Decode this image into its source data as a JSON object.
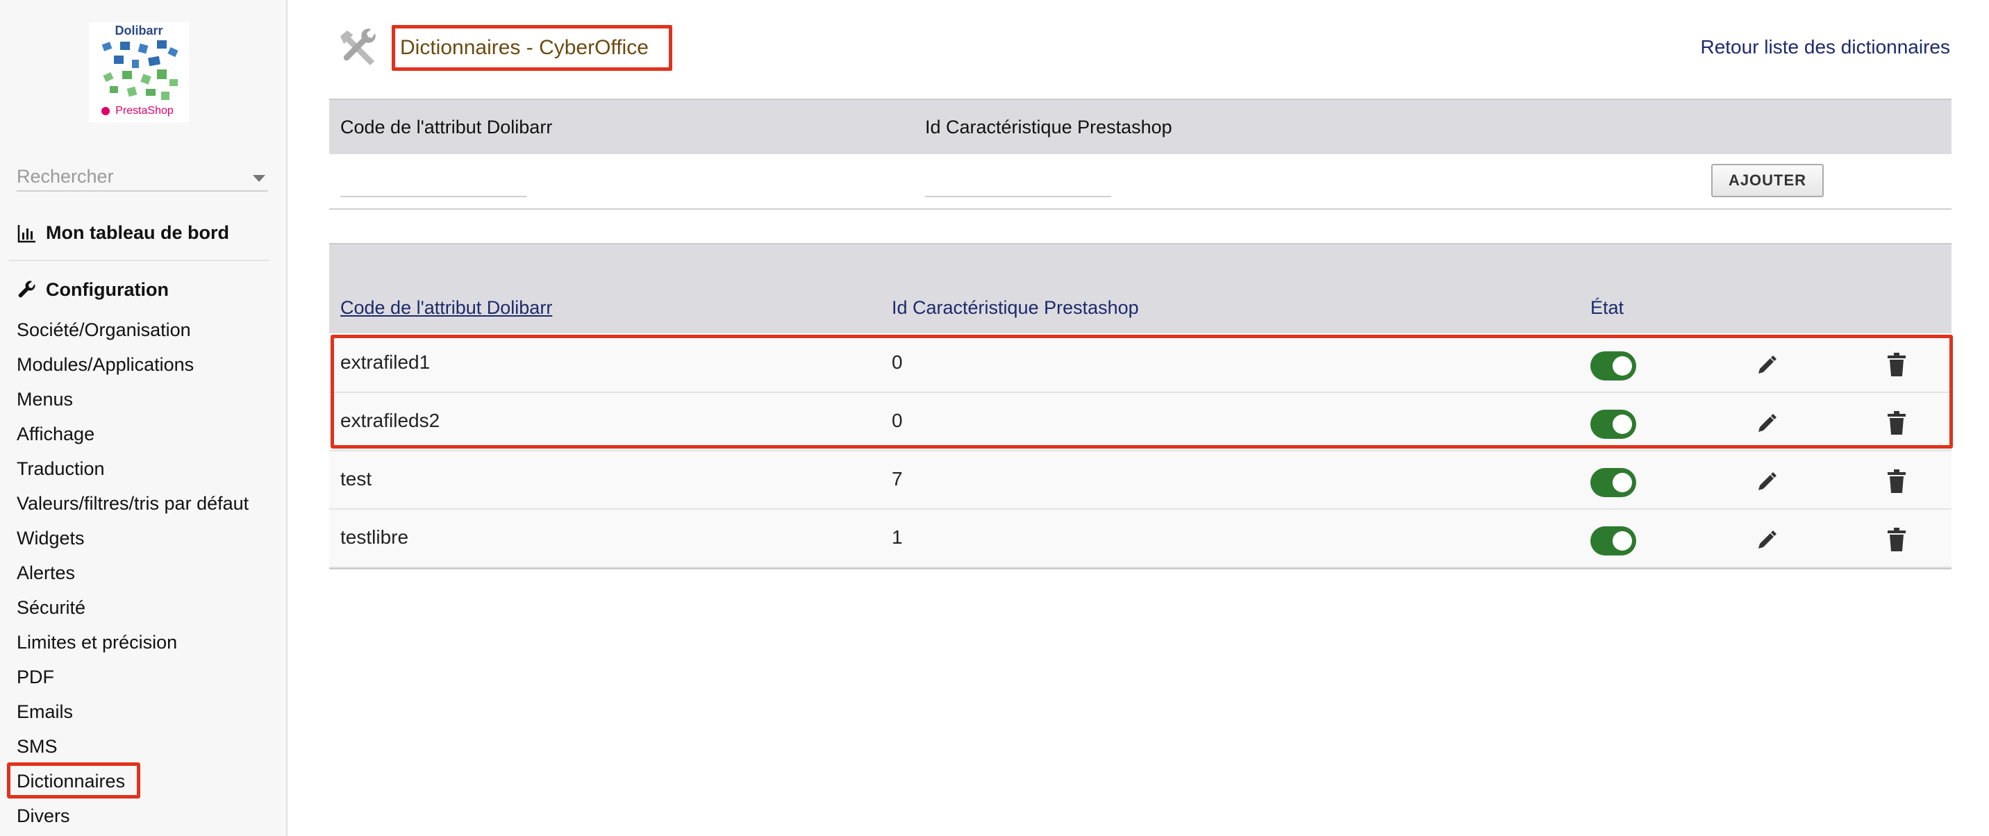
{
  "sidebar": {
    "search_placeholder": "Rechercher",
    "dashboard_label": "Mon tableau de bord",
    "configuration_label": "Configuration",
    "items": [
      {
        "label": "Société/Organisation"
      },
      {
        "label": "Modules/Applications"
      },
      {
        "label": "Menus"
      },
      {
        "label": "Affichage"
      },
      {
        "label": "Traduction"
      },
      {
        "label": "Valeurs/filtres/tris par défaut"
      },
      {
        "label": "Widgets"
      },
      {
        "label": "Alertes"
      },
      {
        "label": "Sécurité"
      },
      {
        "label": "Limites et précision"
      },
      {
        "label": "PDF"
      },
      {
        "label": "Emails"
      },
      {
        "label": "SMS"
      },
      {
        "label": "Dictionnaires"
      },
      {
        "label": "Divers"
      }
    ],
    "active_item": "Dictionnaires"
  },
  "logo": {
    "top_text": "Dolibarr",
    "bottom_text": "PrestaShop"
  },
  "header": {
    "title": "Dictionnaires - CyberOffice",
    "back_link": "Retour liste des dictionnaires"
  },
  "add_form": {
    "col_code": "Code de l'attribut Dolibarr",
    "col_id": "Id Caractéristique Prestashop",
    "code_value": "",
    "id_value": "",
    "add_button": "AJOUTER"
  },
  "list": {
    "col_code": "Code de l'attribut Dolibarr",
    "col_id": "Id Caractéristique Prestashop",
    "col_state": "État",
    "rows": [
      {
        "code": "extrafiled1",
        "id": "0",
        "state": "on"
      },
      {
        "code": "extrafileds2",
        "id": "0",
        "state": "on"
      },
      {
        "code": "test",
        "id": "7",
        "state": "on"
      },
      {
        "code": "testlibre",
        "id": "1",
        "state": "on"
      }
    ]
  },
  "colors": {
    "highlight": "#e0321c",
    "toggle_on": "#2d7a2f",
    "title": "#6b4a10",
    "link": "#1d2a6b",
    "header_bg": "#dcdce0"
  },
  "icons": {
    "title": "tools-icon",
    "dashboard": "bar-chart-icon",
    "configuration": "wrench-icon",
    "edit": "pencil-icon",
    "delete": "trash-icon",
    "search": "chevron-down-icon"
  }
}
